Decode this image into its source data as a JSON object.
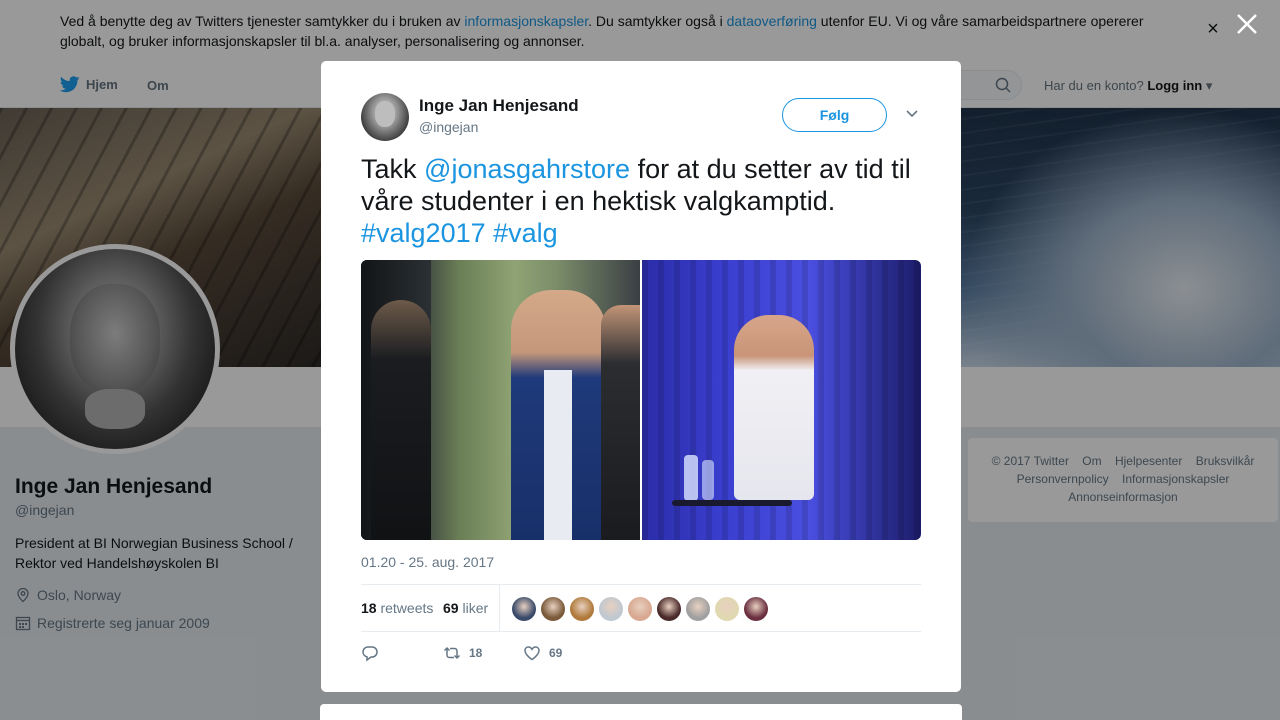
{
  "cookie": {
    "text_before": "Ved å benytte deg av Twitters tjenester samtykker du i bruken av ",
    "link1": "informasjonskapsler",
    "text_mid": ". Du samtykker også i ",
    "link2": "dataoverføring",
    "text_after": " utenfor EU. Vi og våre samarbeidspartnere opererer globalt, og bruker informasjonskapsler til bl.a. analyser, personalisering og annonser.",
    "close_icon": "×"
  },
  "nav": {
    "home": "Hjem",
    "about": "Om",
    "login_prompt": "Har du en konto?",
    "login": "Logg inn"
  },
  "profile": {
    "name": "Inge Jan Henjesand",
    "handle": "@ingejan",
    "bio": "President at BI Norwegian Business School / Rektor ved Handelshøyskolen BI",
    "location": "Oslo, Norway",
    "joined": "Registrerte seg januar 2009"
  },
  "footer": {
    "items": [
      "© 2017 Twitter",
      "Om",
      "Hjelpesenter",
      "Bruksvilkår",
      "Personvernpolicy",
      "Informasjonskapsler",
      "Annonseinformasjon"
    ]
  },
  "tweet": {
    "author_name": "Inge Jan Henjesand",
    "author_handle": "@ingejan",
    "follow_label": "Følg",
    "text_1": "Takk ",
    "mention": "@jonasgahrstore",
    "text_2": " for at du setter av tid til våre studenter i en hektisk valgkamptid. ",
    "hashtag1": "#valg2017",
    "hashtag2": "#valg",
    "timestamp": "01.20 - 25. aug. 2017",
    "retweets_count": "18",
    "retweets_label": "retweets",
    "likes_count": "69",
    "likes_label": "liker",
    "action_retweets": "18",
    "action_likes": "69",
    "liker_avatar_colors": [
      "#3a4a6a",
      "#7a5a3a",
      "#b07a3a",
      "#c0c8d0",
      "#d8a890",
      "#4a2a2a",
      "#a0a0a0",
      "#e0d8b0",
      "#6a3040"
    ]
  },
  "colors": {
    "accent": "#1b95e0",
    "text": "#14171a",
    "muted": "#657786"
  }
}
